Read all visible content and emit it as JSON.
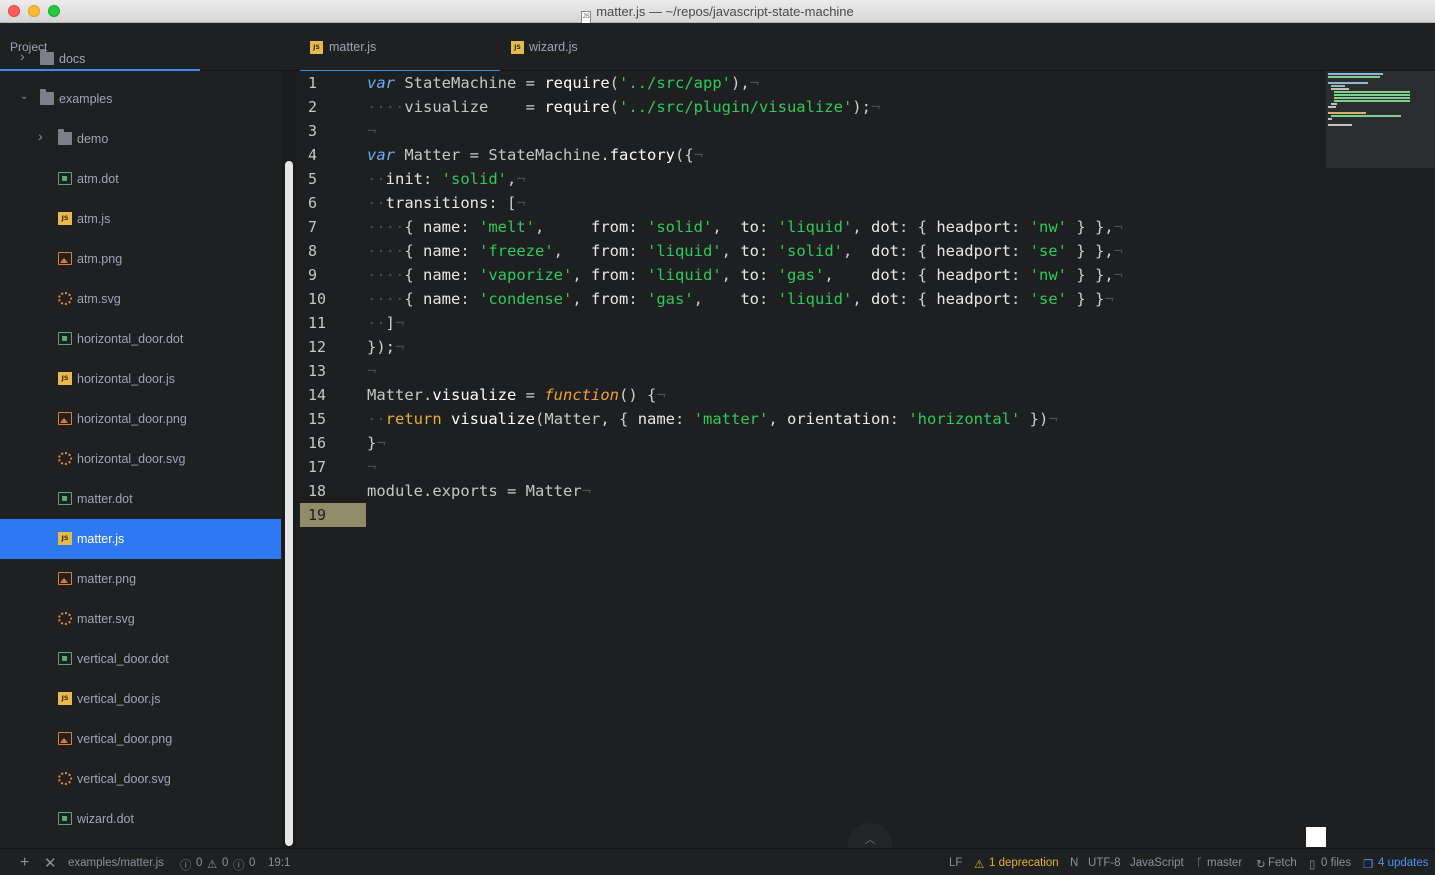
{
  "window": {
    "title": "matter.js — ~/repos/javascript-state-machine",
    "title_icon": "js-file-icon"
  },
  "sidebar": {
    "title": "Project",
    "items": [
      {
        "label": "docs",
        "type": "folder",
        "expanded": false,
        "depth": 1
      },
      {
        "label": "examples",
        "type": "folder",
        "expanded": true,
        "depth": 1
      },
      {
        "label": "demo",
        "type": "folder",
        "expanded": false,
        "depth": 2
      },
      {
        "label": "atm.dot",
        "type": "dot",
        "depth": 2
      },
      {
        "label": "atm.js",
        "type": "js",
        "depth": 2
      },
      {
        "label": "atm.png",
        "type": "png",
        "depth": 2
      },
      {
        "label": "atm.svg",
        "type": "svg",
        "depth": 2
      },
      {
        "label": "horizontal_door.dot",
        "type": "dot",
        "depth": 2
      },
      {
        "label": "horizontal_door.js",
        "type": "js",
        "depth": 2
      },
      {
        "label": "horizontal_door.png",
        "type": "png",
        "depth": 2
      },
      {
        "label": "horizontal_door.svg",
        "type": "svg",
        "depth": 2
      },
      {
        "label": "matter.dot",
        "type": "dot",
        "depth": 2
      },
      {
        "label": "matter.js",
        "type": "js",
        "depth": 2,
        "selected": true
      },
      {
        "label": "matter.png",
        "type": "png",
        "depth": 2
      },
      {
        "label": "matter.svg",
        "type": "svg",
        "depth": 2
      },
      {
        "label": "vertical_door.dot",
        "type": "dot",
        "depth": 2
      },
      {
        "label": "vertical_door.js",
        "type": "js",
        "depth": 2
      },
      {
        "label": "vertical_door.png",
        "type": "png",
        "depth": 2
      },
      {
        "label": "vertical_door.svg",
        "type": "svg",
        "depth": 2
      },
      {
        "label": "wizard.dot",
        "type": "dot",
        "depth": 2
      }
    ]
  },
  "tabs": [
    {
      "label": "matter.js",
      "active": true,
      "icon": "js-file-icon"
    },
    {
      "label": "wizard.js",
      "active": false,
      "icon": "js-file-icon"
    }
  ],
  "editor": {
    "current_line": 19,
    "line_numbers": [
      "1",
      "2",
      "3",
      "4",
      "5",
      "6",
      "7",
      "8",
      "9",
      "10",
      "11",
      "12",
      "13",
      "14",
      "15",
      "16",
      "17",
      "18",
      "19"
    ],
    "lines": [
      [
        [
          "kw",
          "var"
        ],
        [
          "txt",
          " StateMachine "
        ],
        [
          "punc",
          "= "
        ],
        [
          "call",
          "require"
        ],
        [
          "punc",
          "("
        ],
        [
          "str",
          "'../src/app'"
        ],
        [
          "punc",
          "),"
        ],
        [
          "inv",
          "¬"
        ]
      ],
      [
        [
          "inv",
          "····"
        ],
        [
          "txt",
          "visualize    "
        ],
        [
          "punc",
          "= "
        ],
        [
          "call",
          "require"
        ],
        [
          "punc",
          "("
        ],
        [
          "str",
          "'../src/plugin/visualize'"
        ],
        [
          "punc",
          ");"
        ],
        [
          "inv",
          "¬"
        ]
      ],
      [
        [
          "inv",
          "¬"
        ]
      ],
      [
        [
          "kw",
          "var"
        ],
        [
          "txt",
          " Matter "
        ],
        [
          "punc",
          "= "
        ],
        [
          "txt",
          "StateMachine"
        ],
        [
          "punc",
          "."
        ],
        [
          "call",
          "factory"
        ],
        [
          "punc",
          "({"
        ],
        [
          "inv",
          "¬"
        ]
      ],
      [
        [
          "inv",
          "··"
        ],
        [
          "prop",
          "init"
        ],
        [
          "punc",
          ": "
        ],
        [
          "str",
          "'solid'"
        ],
        [
          "punc",
          ","
        ],
        [
          "inv",
          "¬"
        ]
      ],
      [
        [
          "inv",
          "··"
        ],
        [
          "prop",
          "transitions"
        ],
        [
          "punc",
          ": ["
        ],
        [
          "inv",
          "¬"
        ]
      ],
      [
        [
          "inv",
          "····"
        ],
        [
          "punc",
          "{ "
        ],
        [
          "prop",
          "name"
        ],
        [
          "punc",
          ": "
        ],
        [
          "str",
          "'melt'"
        ],
        [
          "punc",
          ",     "
        ],
        [
          "prop",
          "from"
        ],
        [
          "punc",
          ": "
        ],
        [
          "str",
          "'solid'"
        ],
        [
          "punc",
          ",  "
        ],
        [
          "prop",
          "to"
        ],
        [
          "punc",
          ": "
        ],
        [
          "str",
          "'liquid'"
        ],
        [
          "punc",
          ", "
        ],
        [
          "prop",
          "dot"
        ],
        [
          "punc",
          ": { "
        ],
        [
          "prop",
          "headport"
        ],
        [
          "punc",
          ": "
        ],
        [
          "str",
          "'nw'"
        ],
        [
          "punc",
          " } },"
        ],
        [
          "inv",
          "¬"
        ]
      ],
      [
        [
          "inv",
          "····"
        ],
        [
          "punc",
          "{ "
        ],
        [
          "prop",
          "name"
        ],
        [
          "punc",
          ": "
        ],
        [
          "str",
          "'freeze'"
        ],
        [
          "punc",
          ",   "
        ],
        [
          "prop",
          "from"
        ],
        [
          "punc",
          ": "
        ],
        [
          "str",
          "'liquid'"
        ],
        [
          "punc",
          ", "
        ],
        [
          "prop",
          "to"
        ],
        [
          "punc",
          ": "
        ],
        [
          "str",
          "'solid'"
        ],
        [
          "punc",
          ",  "
        ],
        [
          "prop",
          "dot"
        ],
        [
          "punc",
          ": { "
        ],
        [
          "prop",
          "headport"
        ],
        [
          "punc",
          ": "
        ],
        [
          "str",
          "'se'"
        ],
        [
          "punc",
          " } },"
        ],
        [
          "inv",
          "¬"
        ]
      ],
      [
        [
          "inv",
          "····"
        ],
        [
          "punc",
          "{ "
        ],
        [
          "prop",
          "name"
        ],
        [
          "punc",
          ": "
        ],
        [
          "str",
          "'vaporize'"
        ],
        [
          "punc",
          ", "
        ],
        [
          "prop",
          "from"
        ],
        [
          "punc",
          ": "
        ],
        [
          "str",
          "'liquid'"
        ],
        [
          "punc",
          ", "
        ],
        [
          "prop",
          "to"
        ],
        [
          "punc",
          ": "
        ],
        [
          "str",
          "'gas'"
        ],
        [
          "punc",
          ",    "
        ],
        [
          "prop",
          "dot"
        ],
        [
          "punc",
          ": { "
        ],
        [
          "prop",
          "headport"
        ],
        [
          "punc",
          ": "
        ],
        [
          "str",
          "'nw'"
        ],
        [
          "punc",
          " } },"
        ],
        [
          "inv",
          "¬"
        ]
      ],
      [
        [
          "inv",
          "····"
        ],
        [
          "punc",
          "{ "
        ],
        [
          "prop",
          "name"
        ],
        [
          "punc",
          ": "
        ],
        [
          "str",
          "'condense'"
        ],
        [
          "punc",
          ", "
        ],
        [
          "prop",
          "from"
        ],
        [
          "punc",
          ": "
        ],
        [
          "str",
          "'gas'"
        ],
        [
          "punc",
          ",    "
        ],
        [
          "prop",
          "to"
        ],
        [
          "punc",
          ": "
        ],
        [
          "str",
          "'liquid'"
        ],
        [
          "punc",
          ", "
        ],
        [
          "prop",
          "dot"
        ],
        [
          "punc",
          ": { "
        ],
        [
          "prop",
          "headport"
        ],
        [
          "punc",
          ": "
        ],
        [
          "str",
          "'se'"
        ],
        [
          "punc",
          " } }"
        ],
        [
          "inv",
          "¬"
        ]
      ],
      [
        [
          "inv",
          "··"
        ],
        [
          "punc",
          "]"
        ],
        [
          "inv",
          "¬"
        ]
      ],
      [
        [
          "punc",
          "});"
        ],
        [
          "inv",
          "¬"
        ]
      ],
      [
        [
          "inv",
          "¬"
        ]
      ],
      [
        [
          "txt",
          "Matter"
        ],
        [
          "punc",
          "."
        ],
        [
          "call",
          "visualize"
        ],
        [
          "punc",
          " = "
        ],
        [
          "fnkw",
          "function"
        ],
        [
          "punc",
          "() {"
        ],
        [
          "inv",
          "¬"
        ]
      ],
      [
        [
          "inv",
          "··"
        ],
        [
          "ret",
          "return"
        ],
        [
          "txt",
          " "
        ],
        [
          "call",
          "visualize"
        ],
        [
          "punc",
          "("
        ],
        [
          "txt",
          "Matter"
        ],
        [
          "punc",
          ", { "
        ],
        [
          "prop",
          "name"
        ],
        [
          "punc",
          ": "
        ],
        [
          "str",
          "'matter'"
        ],
        [
          "punc",
          ", "
        ],
        [
          "prop",
          "orientation"
        ],
        [
          "punc",
          ": "
        ],
        [
          "str",
          "'horizontal'"
        ],
        [
          "punc",
          " })"
        ],
        [
          "inv",
          "¬"
        ]
      ],
      [
        [
          "punc",
          "}"
        ],
        [
          "inv",
          "¬"
        ]
      ],
      [
        [
          "inv",
          "¬"
        ]
      ],
      [
        [
          "txt",
          "module"
        ],
        [
          "punc",
          "."
        ],
        [
          "txt",
          "exports "
        ],
        [
          "punc",
          "= "
        ],
        [
          "txt",
          "Matter"
        ],
        [
          "inv",
          "¬"
        ]
      ],
      []
    ]
  },
  "statusbar": {
    "add_icon": "plus-icon",
    "close_icon": "close-icon",
    "file_path": "examples/matter.js",
    "errors": "0",
    "warnings": "0",
    "infos": "0",
    "cursor": "19:1",
    "line_ending": "LF",
    "deprecation": "1 deprecation",
    "n_label": "N",
    "encoding": "UTF-8",
    "grammar": "JavaScript",
    "branch": "master",
    "fetch": "Fetch",
    "files": "0 files",
    "updates": "4 updates"
  },
  "colors": {
    "accent": "#3a8cf5",
    "selected_bg": "#2e78f2",
    "string": "#2ec95a",
    "keyword": "#6ab0f3",
    "function_keyword": "#f0a030",
    "warning": "#e5b030"
  }
}
